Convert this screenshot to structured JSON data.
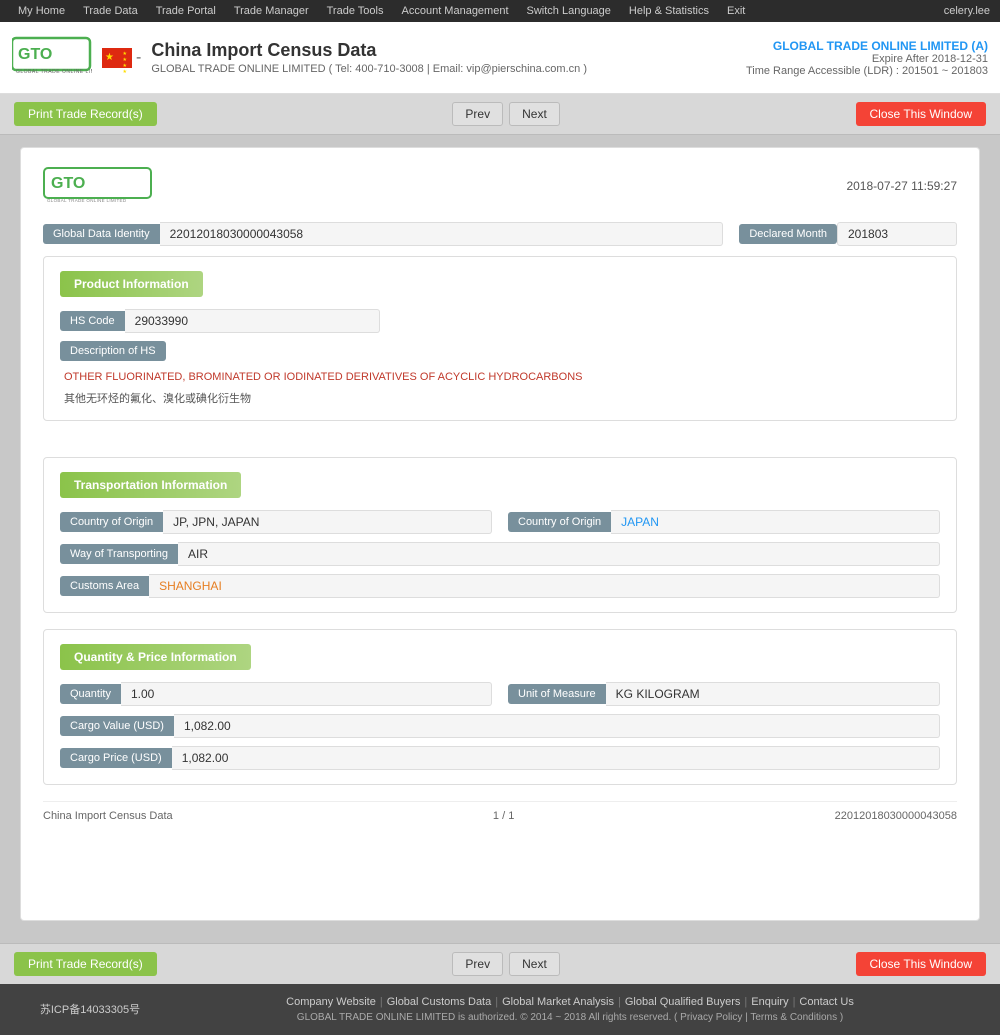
{
  "nav": {
    "items": [
      "My Home",
      "Trade Data",
      "Trade Portal",
      "Trade Manager",
      "Trade Tools",
      "Account Management",
      "Switch Language",
      "Help & Statistics",
      "Exit"
    ],
    "user": "celery.lee"
  },
  "header": {
    "title": "China Import Census Data",
    "dash": "-",
    "sub": "GLOBAL TRADE ONLINE LIMITED ( Tel: 400-710-3008 | Email: vip@pierschina.com.cn )",
    "company": "GLOBAL TRADE ONLINE LIMITED (A)",
    "expire": "Expire After 2018-12-31",
    "range": "Time Range Accessible (LDR) : 201501 ~ 201803"
  },
  "actions": {
    "print": "Print Trade Record(s)",
    "prev": "Prev",
    "next": "Next",
    "close": "Close This Window"
  },
  "record": {
    "date": "2018-07-27 11:59:27",
    "global_data_identity_label": "Global Data Identity",
    "global_data_identity_value": "22012018030000043058",
    "declared_month_label": "Declared Month",
    "declared_month_value": "201803",
    "sections": {
      "product": {
        "title": "Product Information",
        "hs_code_label": "HS Code",
        "hs_code_value": "29033990",
        "desc_label": "Description of HS",
        "desc_en": "OTHER FLUORINATED, BROMINATED OR IODINATED DERIVATIVES OF ACYCLIC HYDROCARBONS",
        "desc_cn": "其他无环烃的氟化、溴化或碘化衍生物"
      },
      "transport": {
        "title": "Transportation Information",
        "country_of_origin_label": "Country of Origin",
        "country_of_origin_value": "JP, JPN, JAPAN",
        "country_of_origin2_label": "Country of Origin",
        "country_of_origin2_value": "JAPAN",
        "way_label": "Way of Transporting",
        "way_value": "AIR",
        "customs_label": "Customs Area",
        "customs_value": "SHANGHAI"
      },
      "quantity": {
        "title": "Quantity & Price Information",
        "quantity_label": "Quantity",
        "quantity_value": "1.00",
        "unit_label": "Unit of Measure",
        "unit_value": "KG KILOGRAM",
        "cargo_value_label": "Cargo Value (USD)",
        "cargo_value_value": "1,082.00",
        "cargo_price_label": "Cargo Price (USD)",
        "cargo_price_value": "1,082.00"
      }
    },
    "footer": {
      "left": "China Import Census Data",
      "center": "1 / 1",
      "right": "22012018030000043058"
    }
  },
  "footer": {
    "icp": "苏ICP备14033305号",
    "links": [
      "Company Website",
      "Global Customs Data",
      "Global Market Analysis",
      "Global Qualified Buyers",
      "Enquiry",
      "Contact Us"
    ],
    "copy": "GLOBAL TRADE ONLINE LIMITED is authorized. © 2014 ~ 2018 All rights reserved.  (  Privacy Policy | Terms & Conditions  )"
  }
}
